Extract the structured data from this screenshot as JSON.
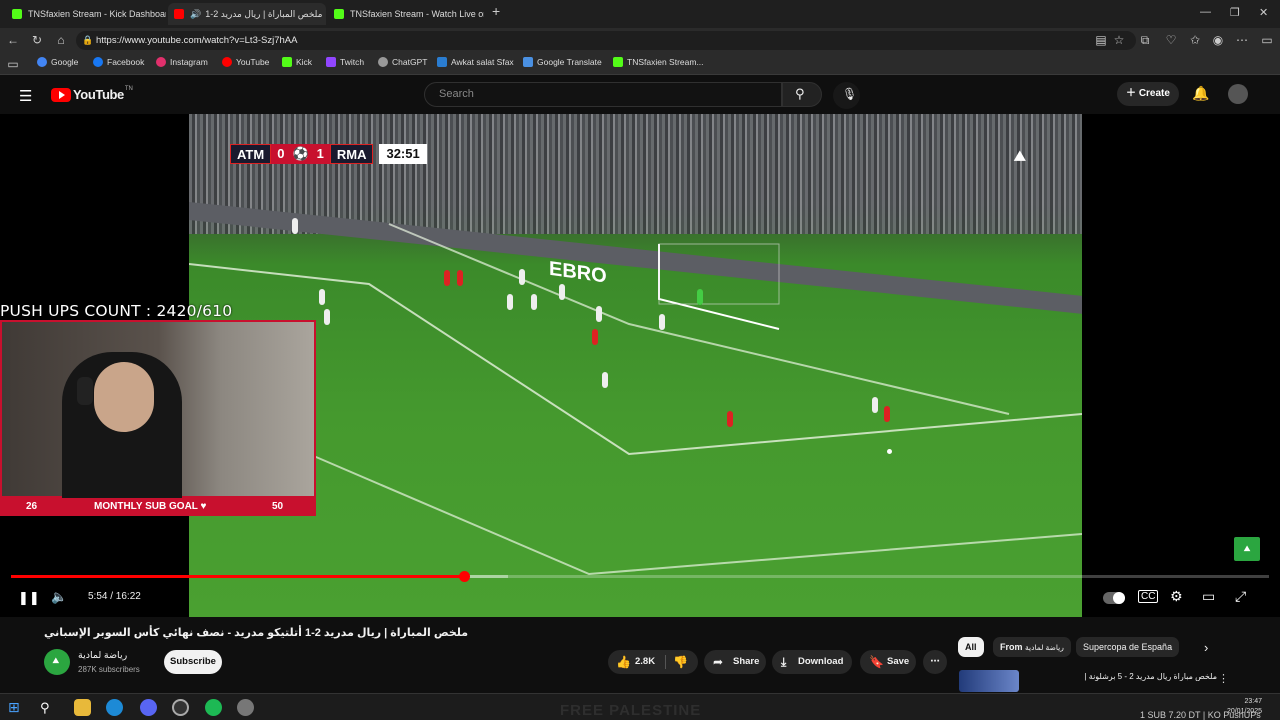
{
  "browser": {
    "tabs": [
      {
        "label": "TNSfaxien Stream - Kick Dashboar",
        "active": false
      },
      {
        "label": "ملخص المباراة | ريال مدريد 2-1",
        "active": true
      },
      {
        "label": "TNSfaxien Stream - Watch Live on",
        "active": false
      }
    ],
    "url": "https://www.youtube.com/watch?v=Lt3-Szj7hAA",
    "bookmarks": [
      "Google",
      "Facebook",
      "Instagram",
      "YouTube",
      "Kick",
      "Twitch",
      "ChatGPT",
      "Awkat salat Sfax",
      "Google Translate",
      "TNSfaxien Stream..."
    ]
  },
  "youtube": {
    "logo_text": "YouTube",
    "logo_sup": "TN",
    "search_placeholder": "Search",
    "create_label": "Create"
  },
  "video": {
    "scorebug": {
      "home": "ATM",
      "home_score": "0",
      "away_score": "1",
      "away": "RMA",
      "clock": "32:51"
    },
    "pushups_text": "PUSH UPS COUNT : 2420/610",
    "sub_goal": {
      "current": "26",
      "label": "MONTHLY SUB GOAL ♥",
      "target": "50"
    },
    "timecode": "5:54 / 16:22",
    "progress_played": 0.36,
    "progress_loaded": 0.395
  },
  "meta": {
    "title": "ملخص المباراة | ريال مدريد 2-1 أتلتيكو مدريد - نصف نهائي كأس السوبر الإسباني",
    "channel_name": "رياضة لمادية",
    "subscribers": "287K subscribers",
    "subscribe_label": "Subscribe",
    "likes": "2.8K",
    "share_label": "Share",
    "download_label": "Download",
    "save_label": "Save"
  },
  "chips": {
    "all": "All",
    "from_prefix": "From",
    "from_channel": "رياضة لمادية",
    "topic": "Supercopa de España"
  },
  "suggestion": {
    "title": "ملخص مباراة ريال مدريد 2 - 5 برشلونة |"
  },
  "taskbar": {
    "time": "23:47",
    "date": "20/01/2025",
    "ticker": "1 SUB 7.20 DT | KO PushUPs",
    "watermark": "FREE PALESTINE"
  },
  "colors": {
    "accent": "#ff0000",
    "overlay_red": "#c8102e"
  }
}
